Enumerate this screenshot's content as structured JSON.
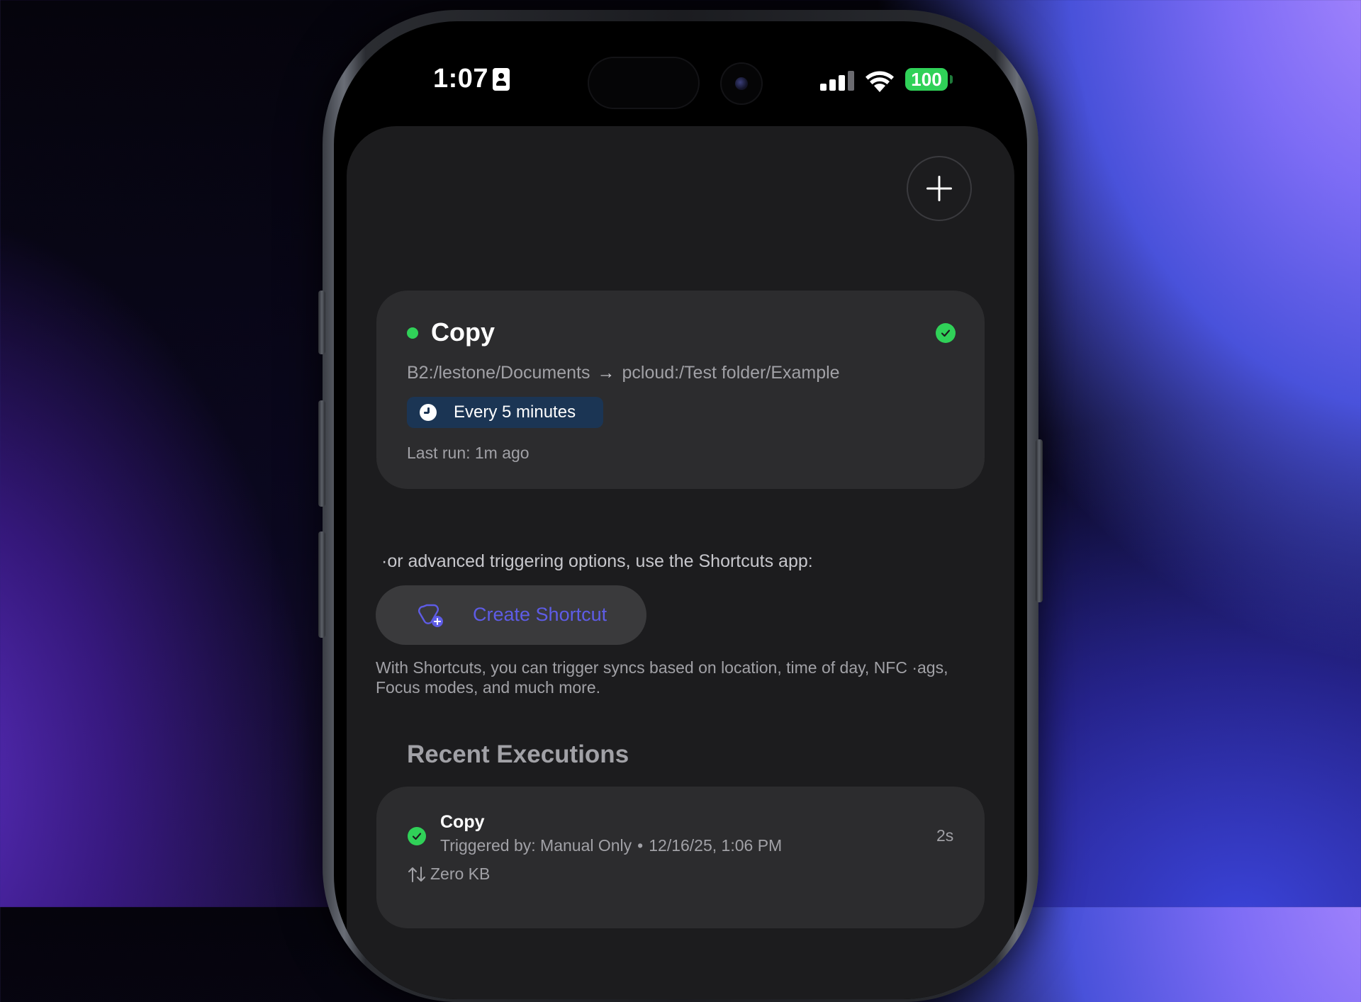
{
  "status_bar": {
    "time": "1:07",
    "battery": "100"
  },
  "toolbar": {
    "add_icon": "plus-icon"
  },
  "job": {
    "title": "Copy",
    "source": "B2:/lestone/Documents",
    "destination": "pcloud:/Test folder/Example",
    "schedule": "Every 5 minutes",
    "last_run": "Last run: 1m ago",
    "status_color": "#30d158"
  },
  "shortcuts": {
    "hint": "·or advanced triggering options, use the Shortcuts app:",
    "button_label": "Create Shortcut",
    "description": "With Shortcuts, you can trigger syncs based on location, time of day, NFC ·ags, Focus modes, and much more.",
    "accent_color": "#5e5ce6"
  },
  "recent": {
    "title": "Recent Executions",
    "items": [
      {
        "title": "Copy",
        "trigger": "Triggered by: Manual Only",
        "separator": "•",
        "datetime": "12/16/25, 1:06 PM",
        "duration": "2s",
        "size": "Zero KB"
      }
    ]
  }
}
